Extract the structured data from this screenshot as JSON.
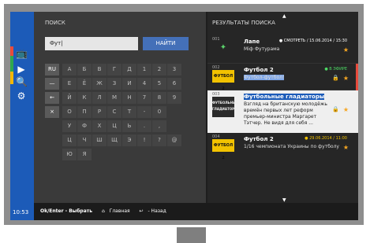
{
  "rail": {
    "time": "10:53",
    "icons": [
      "tv-icon",
      "play-icon",
      "search-icon",
      "settings-icon"
    ],
    "stripe_colors": [
      "#e84b3c",
      "#2fa84f",
      "#f2b705"
    ]
  },
  "search_panel": {
    "title": "ПОИСК",
    "query": "Фут|",
    "find_label": "НАЙТИ",
    "side_keys": [
      "RU",
      "—",
      "←",
      "×"
    ],
    "letters": [
      [
        "А",
        "Б",
        "В",
        "Г",
        "Д",
        "1",
        "2",
        "3"
      ],
      [
        "Е",
        "Ё",
        "Ж",
        "З",
        "И",
        "4",
        "5",
        "6"
      ],
      [
        "Й",
        "К",
        "Л",
        "М",
        "Н",
        "7",
        "8",
        "9"
      ],
      [
        "О",
        "П",
        "Р",
        "С",
        "Т",
        "-",
        "0",
        ""
      ],
      [
        "У",
        "Ф",
        "Х",
        "Ц",
        "Ь",
        ".",
        ",",
        ""
      ],
      [
        "Ц",
        "Ч",
        "Ш",
        "Щ",
        "Э",
        "!",
        "?",
        "@"
      ],
      [
        "Ю",
        "Я",
        "",
        "",
        "",
        "",
        "",
        ""
      ]
    ]
  },
  "results_panel": {
    "title": "РЕЗУЛЬТАТЫ ПОИСКА",
    "items": [
      {
        "num": "001",
        "thumb": "logo",
        "name": "Лапе",
        "sub": "Мiф Футурама",
        "meta": "● СМОТРЕТЬ / 15.06.2014 / 15:30",
        "star": "★"
      },
      {
        "num": "002",
        "thumb": "ФУТБОЛ 2",
        "name": "Футбол 2",
        "sub": "Футбол-футбол!",
        "meta": "● В ЭФИРЕ",
        "star": "★",
        "lock": "🔒"
      },
      {
        "num": "003",
        "thumb": "ФУТБОЛЬНЫЕ ГЛАДИАТОРЫ",
        "name": "Футбольные гладиаторы",
        "sub": "Взгляд на британскую молодёжь времён первых лет реформ премьер-министра Маргарет Тэтчер. Не видя для себя ...",
        "star": "★",
        "lock": "🔒"
      },
      {
        "num": "004",
        "thumb": "ФУТБОЛ 2",
        "name": "Футбол 2",
        "sub": "1/16 чемпионата Украины по футболу",
        "meta": "● 29.06.2014 / 11:00",
        "star": "★"
      }
    ]
  },
  "bottom_bar": {
    "hint1": "Ok/Enter - Выбрать",
    "hint2": "Главная",
    "hint3": "- Назад"
  }
}
